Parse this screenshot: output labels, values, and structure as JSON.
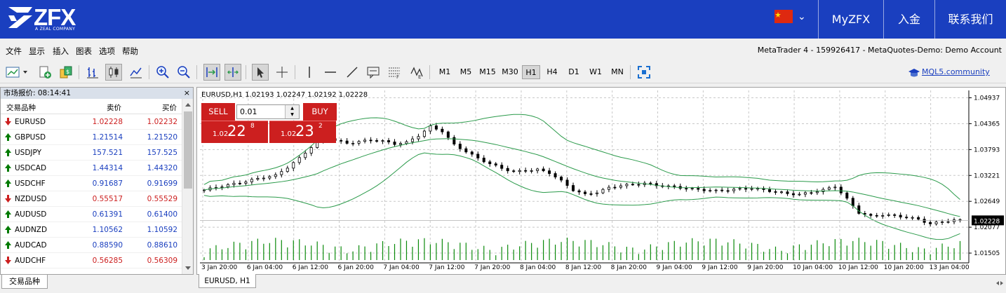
{
  "header": {
    "brand": "ZFX",
    "tagline": "A ZEAL COMPANY",
    "links": [
      "MyZFX",
      "入金",
      "联系我们"
    ]
  },
  "menu": {
    "items": [
      "文件",
      "显示",
      "插入",
      "图表",
      "选项",
      "帮助"
    ],
    "account": "MetaTrader 4 - 159926417 - MetaQuotes-Demo: Demo Account"
  },
  "toolbar": {
    "timeframes": [
      "M1",
      "M5",
      "M15",
      "M30",
      "H1",
      "H4",
      "D1",
      "W1",
      "MN"
    ],
    "active_timeframe": "H1",
    "community_link": "MQL5.community"
  },
  "market_watch": {
    "title": "市场报价: 08:14:41",
    "close_label": "×",
    "columns": {
      "symbol": "交易品种",
      "bid": "卖价",
      "ask": "买价"
    },
    "rows": [
      {
        "symbol": "EURUSD",
        "bid": "1.02228",
        "ask": "1.02232",
        "dir": "down"
      },
      {
        "symbol": "GBPUSD",
        "bid": "1.21514",
        "ask": "1.21520",
        "dir": "up"
      },
      {
        "symbol": "USDJPY",
        "bid": "157.521",
        "ask": "157.525",
        "dir": "up"
      },
      {
        "symbol": "USDCAD",
        "bid": "1.44314",
        "ask": "1.44320",
        "dir": "up"
      },
      {
        "symbol": "USDCHF",
        "bid": "0.91687",
        "ask": "0.91699",
        "dir": "up"
      },
      {
        "symbol": "NZDUSD",
        "bid": "0.55517",
        "ask": "0.55529",
        "dir": "down"
      },
      {
        "symbol": "AUDUSD",
        "bid": "0.61391",
        "ask": "0.61400",
        "dir": "up"
      },
      {
        "symbol": "AUDNZD",
        "bid": "1.10562",
        "ask": "1.10592",
        "dir": "up"
      },
      {
        "symbol": "AUDCAD",
        "bid": "0.88590",
        "ask": "0.88610",
        "dir": "up"
      },
      {
        "symbol": "AUDCHF",
        "bid": "0.56285",
        "ask": "0.56309",
        "dir": "down"
      }
    ],
    "tab_label": "交易品种"
  },
  "chart": {
    "info": "EURUSD,H1  1.02193 1.02247 1.02192 1.02228",
    "tab_label": "EURUSD, H1",
    "trade": {
      "sell_label": "SELL",
      "buy_label": "BUY",
      "lot": "0.01",
      "sell_price": {
        "prefix": "1.02",
        "big": "22",
        "sup": "8"
      },
      "buy_price": {
        "prefix": "1.02",
        "big": "23",
        "sup": "2"
      }
    },
    "colors": {
      "up": "#007a00",
      "down": "#cc1f1f",
      "band": "#2a9a4a",
      "volume": "#0b8a0b",
      "grid": "#c8c8c8",
      "candle": "#000000"
    }
  },
  "chart_data": {
    "type": "candlestick",
    "symbol": "EURUSD",
    "timeframe": "H1",
    "x_labels": [
      "3 Jan 20:00",
      "6 Jan 04:00",
      "6 Jan 12:00",
      "6 Jan 20:00",
      "7 Jan 04:00",
      "7 Jan 12:00",
      "7 Jan 20:00",
      "8 Jan 04:00",
      "8 Jan 12:00",
      "8 Jan 20:00",
      "9 Jan 04:00",
      "9 Jan 12:00",
      "9 Jan 20:00",
      "10 Jan 04:00",
      "10 Jan 12:00",
      "10 Jan 20:00",
      "13 Jan 04:00"
    ],
    "y_ticks": [
      "1.04937",
      "1.04365",
      "1.03793",
      "1.03221",
      "1.02649",
      "1.02077",
      "1.01505"
    ],
    "ylim": [
      1.0132,
      1.051
    ],
    "last_price": "1.02228",
    "close_path": [
      1.029,
      1.0296,
      1.0301,
      1.0306,
      1.0312,
      1.0318,
      1.0322,
      1.034,
      1.036,
      1.0385,
      1.041,
      1.04,
      1.0393,
      1.0397,
      1.04,
      1.0398,
      1.0392,
      1.0395,
      1.041,
      1.043,
      1.042,
      1.039,
      1.0375,
      1.036,
      1.0348,
      1.0338,
      1.033,
      1.0333,
      1.0335,
      1.0328,
      1.031,
      1.029,
      1.028,
      1.0285,
      1.0295,
      1.03,
      1.0302,
      1.0305,
      1.03,
      1.0298,
      1.0295,
      1.0292,
      1.029,
      1.0288,
      1.029,
      1.0292,
      1.0294,
      1.029,
      1.0286,
      1.0282,
      1.028,
      1.0285,
      1.029,
      1.0298,
      1.027,
      1.024,
      1.0232,
      1.0235,
      1.0233,
      1.023,
      1.0225,
      1.0215,
      1.022,
      1.0223
    ]
  }
}
